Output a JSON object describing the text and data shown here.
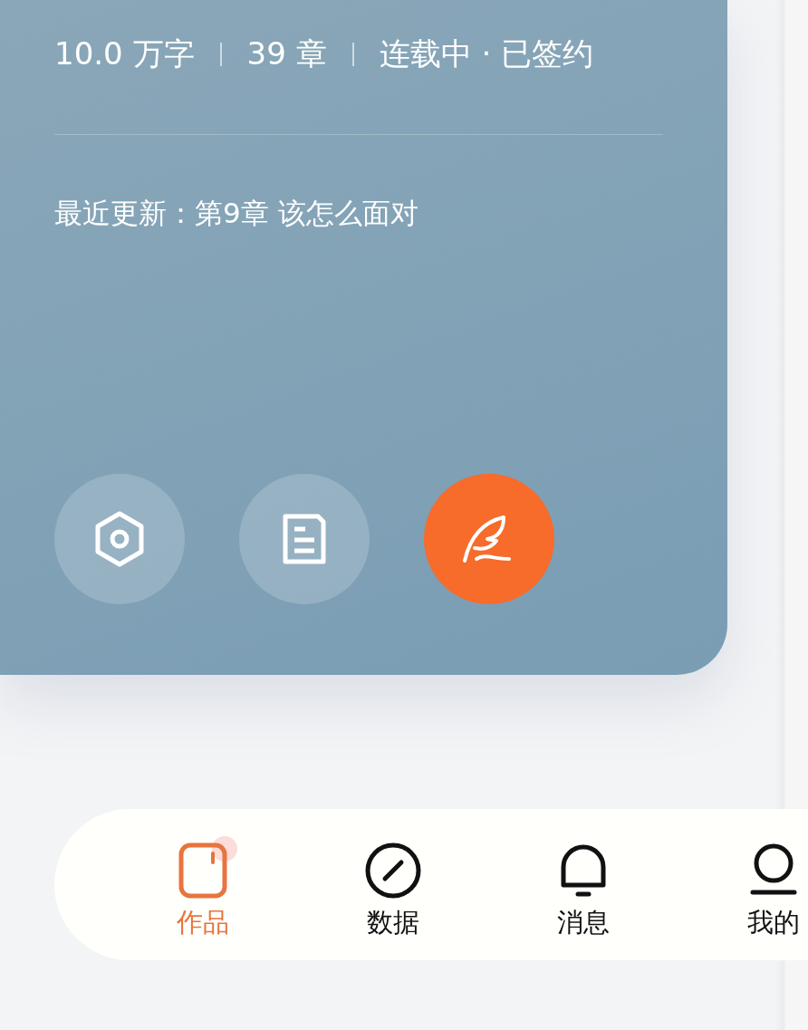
{
  "work_card": {
    "stats": [
      "10.0 万字",
      "39 章",
      "连载中 · 已签约"
    ],
    "latest_update": "最近更新：第9章 该怎么面对",
    "actions": [
      {
        "kind": "settings",
        "primary": false
      },
      {
        "kind": "document",
        "primary": false
      },
      {
        "kind": "write",
        "primary": true
      }
    ]
  },
  "bottom_nav": [
    {
      "kind": "works",
      "label": "作品",
      "selected": true,
      "dot": true
    },
    {
      "kind": "data",
      "label": "数据",
      "selected": false,
      "dot": false
    },
    {
      "kind": "messages",
      "label": "消息",
      "selected": false,
      "dot": false
    },
    {
      "kind": "profile",
      "label": "我的",
      "selected": false,
      "dot": false
    }
  ]
}
